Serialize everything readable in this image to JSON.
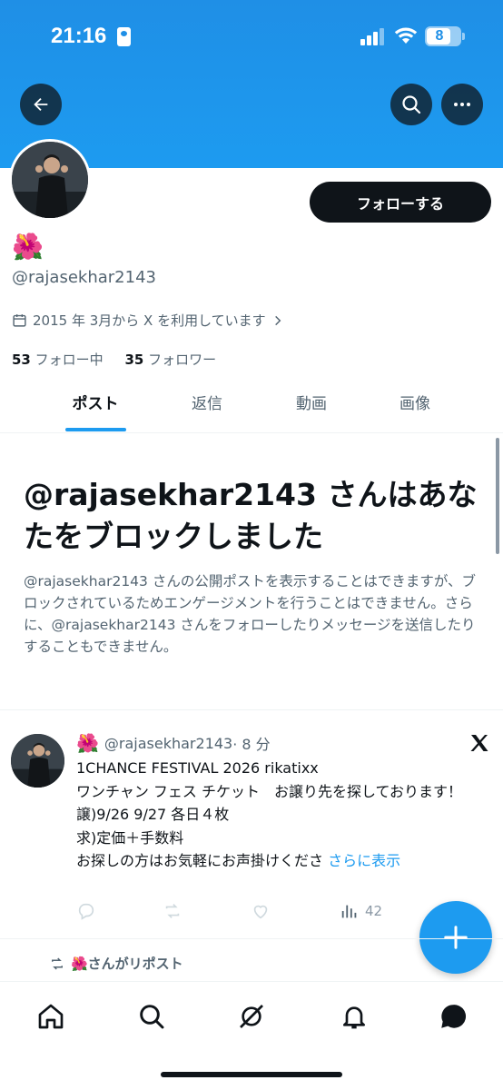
{
  "status_bar": {
    "time": "21:16",
    "battery": "8"
  },
  "header": {
    "back_icon": "arrow-left-icon",
    "search_icon": "search-icon",
    "more_icon": "more-dots-icon"
  },
  "profile": {
    "display_name": "🌺",
    "handle": "@rajasekhar2143",
    "joined": "2015 年 3月から X を利用しています",
    "following_count": "53",
    "following_label": " フォロー中",
    "followers_count": "35",
    "followers_label": " フォロワー",
    "follow_button": "フォローする"
  },
  "tabs": [
    {
      "label": "ポスト",
      "active": true
    },
    {
      "label": "返信",
      "active": false
    },
    {
      "label": "動画",
      "active": false
    },
    {
      "label": "画像",
      "active": false
    }
  ],
  "blocked": {
    "title": "@rajasekhar2143 さんはあなたをブロックしました",
    "description": "@rajasekhar2143 さんの公開ポストを表示することはできますが、ブロックされているためエンゲージメントを行うことはできません。さらに、@rajasekhar2143 さんをフォローしたりメッセージを送信したりすることもできません。"
  },
  "post": {
    "name": "🌺",
    "handle": "@rajasekhar2143",
    "time": "· 8 分",
    "text": "1CHANCE FESTIVAL 2026 rikatixx\nワンチャン フェス チケット　お譲り先を探しております！\n譲)9/26 9/27 各日４枚\n求)定価＋手数料\nお探しの方はお気軽にお声掛けくださ",
    "show_more": "さらに表示",
    "views": "42"
  },
  "repost": {
    "label": "🌺さんがリポスト"
  },
  "colors": {
    "accent": "#1d9bf0",
    "text": "#0f1419",
    "secondary": "#536471"
  }
}
